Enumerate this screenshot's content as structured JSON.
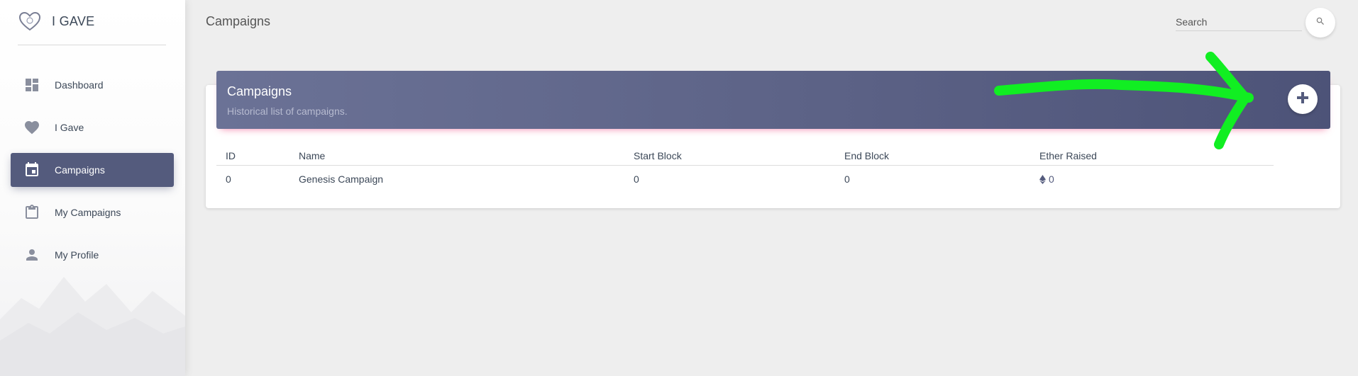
{
  "brand": {
    "name": "I GAVE",
    "logo_icon": "heart-outline-icon"
  },
  "sidebar": {
    "items": [
      {
        "label": "Dashboard",
        "icon": "dashboard-icon",
        "active": false
      },
      {
        "label": "I Gave",
        "icon": "heart-icon",
        "active": false
      },
      {
        "label": "Campaigns",
        "icon": "calendar-icon",
        "active": true
      },
      {
        "label": "My Campaigns",
        "icon": "clipboard-icon",
        "active": false
      },
      {
        "label": "My Profile",
        "icon": "person-icon",
        "active": false
      }
    ]
  },
  "topbar": {
    "title": "Campaigns",
    "search_placeholder": "Search",
    "search_icon": "search-icon"
  },
  "card": {
    "title": "Campaigns",
    "subtitle": "Historical list of campaigns.",
    "add_icon": "plus-icon"
  },
  "table": {
    "columns": [
      "ID",
      "Name",
      "Start Block",
      "End Block",
      "Ether Raised"
    ],
    "rows": [
      {
        "id": "0",
        "name": "Genesis Campaign",
        "start_block": "0",
        "end_block": "0",
        "ether_raised": "0"
      }
    ]
  },
  "colors": {
    "accent": "#545b7d",
    "header_gradient_start": "#6b7296",
    "header_gradient_end": "#4d5378",
    "annotation_arrow": "#11ee22"
  }
}
